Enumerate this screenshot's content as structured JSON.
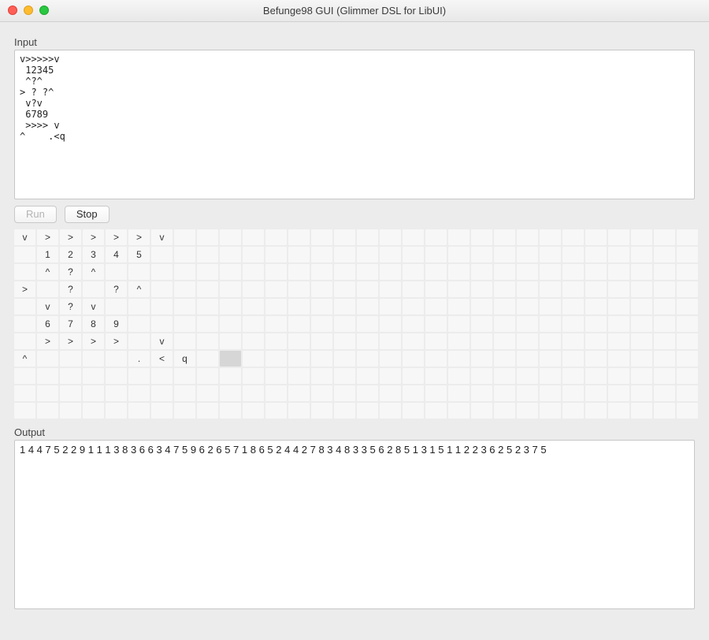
{
  "window": {
    "title": "Befunge98 GUI (Glimmer DSL for LibUI)"
  },
  "labels": {
    "input": "Input",
    "output": "Output"
  },
  "buttons": {
    "run": "Run",
    "stop": "Stop",
    "run_enabled": false,
    "stop_enabled": true
  },
  "input_text": "v>>>>>v\n 12345\n ^?^\n> ? ?^\n v?v\n 6789\n >>>> v\n^    .<q",
  "grid": {
    "cols": 30,
    "rows": 11,
    "highlight": {
      "row": 7,
      "col": 9
    },
    "cells": [
      [
        "v",
        ">",
        ">",
        ">",
        ">",
        ">",
        "v",
        "",
        "",
        "",
        "",
        "",
        "",
        "",
        "",
        "",
        "",
        "",
        "",
        "",
        "",
        "",
        "",
        "",
        "",
        "",
        "",
        "",
        "",
        ""
      ],
      [
        "",
        "1",
        "2",
        "3",
        "4",
        "5",
        "",
        "",
        "",
        "",
        "",
        "",
        "",
        "",
        "",
        "",
        "",
        "",
        "",
        "",
        "",
        "",
        "",
        "",
        "",
        "",
        "",
        "",
        "",
        ""
      ],
      [
        "",
        "^",
        "?",
        "^",
        "",
        "",
        "",
        "",
        "",
        "",
        "",
        "",
        "",
        "",
        "",
        "",
        "",
        "",
        "",
        "",
        "",
        "",
        "",
        "",
        "",
        "",
        "",
        "",
        "",
        ""
      ],
      [
        ">",
        "",
        "?",
        "",
        "?",
        "^",
        "",
        "",
        "",
        "",
        "",
        "",
        "",
        "",
        "",
        "",
        "",
        "",
        "",
        "",
        "",
        "",
        "",
        "",
        "",
        "",
        "",
        "",
        "",
        ""
      ],
      [
        "",
        "v",
        "?",
        "v",
        "",
        "",
        "",
        "",
        "",
        "",
        "",
        "",
        "",
        "",
        "",
        "",
        "",
        "",
        "",
        "",
        "",
        "",
        "",
        "",
        "",
        "",
        "",
        "",
        "",
        ""
      ],
      [
        "",
        "6",
        "7",
        "8",
        "9",
        "",
        "",
        "",
        "",
        "",
        "",
        "",
        "",
        "",
        "",
        "",
        "",
        "",
        "",
        "",
        "",
        "",
        "",
        "",
        "",
        "",
        "",
        "",
        "",
        ""
      ],
      [
        "",
        ">",
        ">",
        ">",
        ">",
        "",
        "v",
        "",
        "",
        "",
        "",
        "",
        "",
        "",
        "",
        "",
        "",
        "",
        "",
        "",
        "",
        "",
        "",
        "",
        "",
        "",
        "",
        "",
        "",
        ""
      ],
      [
        "^",
        "",
        "",
        "",
        "",
        ".",
        "<",
        "q",
        "",
        "",
        "",
        "",
        "",
        "",
        "",
        "",
        "",
        "",
        "",
        "",
        "",
        "",
        "",
        "",
        "",
        "",
        "",
        "",
        "",
        ""
      ],
      [
        "",
        "",
        "",
        "",
        "",
        "",
        "",
        "",
        "",
        "",
        "",
        "",
        "",
        "",
        "",
        "",
        "",
        "",
        "",
        "",
        "",
        "",
        "",
        "",
        "",
        "",
        "",
        "",
        "",
        ""
      ],
      [
        "",
        "",
        "",
        "",
        "",
        "",
        "",
        "",
        "",
        "",
        "",
        "",
        "",
        "",
        "",
        "",
        "",
        "",
        "",
        "",
        "",
        "",
        "",
        "",
        "",
        "",
        "",
        "",
        "",
        ""
      ],
      [
        "",
        "",
        "",
        "",
        "",
        "",
        "",
        "",
        "",
        "",
        "",
        "",
        "",
        "",
        "",
        "",
        "",
        "",
        "",
        "",
        "",
        "",
        "",
        "",
        "",
        "",
        "",
        "",
        "",
        ""
      ]
    ]
  },
  "output_text": "1 4 4 7 5 2 2 9 1 1 1 3 8 3 6 6 3 4 7 5 9 6 2 6 5 7 1 8 6 5 2 4 4 2 7 8 3 4 8 3 3 5 6 2 8 5 1 3 1 5 1 1 2 2 3 6 2 5 2 3 7 5 "
}
